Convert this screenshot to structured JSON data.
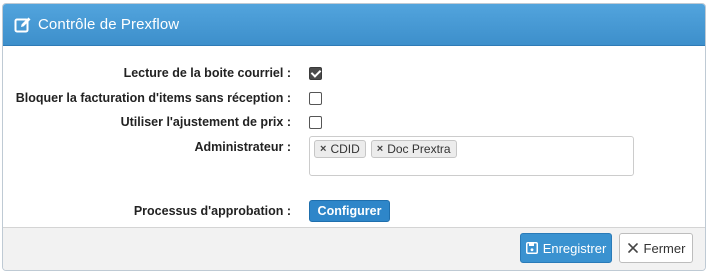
{
  "header": {
    "title": "Contrôle de Prexflow",
    "icon": "edit-icon"
  },
  "form": {
    "mail_reading": {
      "label": "Lecture de la boite courriel :",
      "checked": true
    },
    "block_billing": {
      "label": "Bloquer la facturation d'items sans réception :",
      "checked": false
    },
    "price_adjustment": {
      "label": "Utiliser l'ajustement de prix :",
      "checked": false
    },
    "administrator": {
      "label": "Administrateur :",
      "tags": [
        "CDID",
        "Doc Prextra"
      ]
    },
    "approval_process": {
      "label": "Processus d'approbation :",
      "button_label": "Configurer"
    }
  },
  "footer": {
    "save_label": "Enregistrer",
    "close_label": "Fermer"
  },
  "colors": {
    "header": "#3d8fcb",
    "primary_button": "#2e86c9"
  }
}
